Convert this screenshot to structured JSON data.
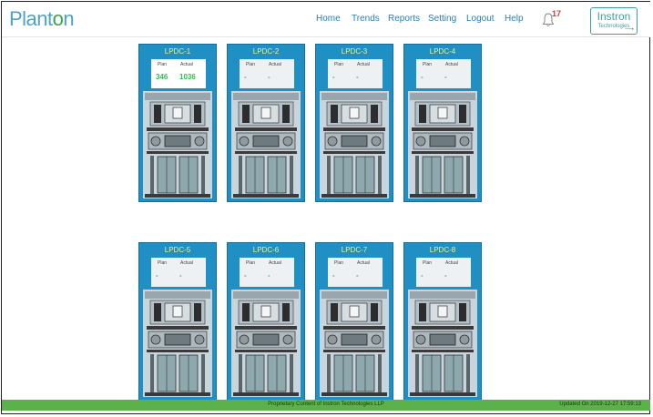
{
  "header": {
    "logo": {
      "pre": "Plant",
      "leaf": "o",
      "post": "n"
    },
    "nav": [
      "Home",
      "Trends",
      "Reports",
      "Setting",
      "Logout",
      "Help"
    ],
    "notification_count": "17",
    "brand": {
      "line1": "Instron",
      "line2": "Technologies"
    }
  },
  "cards": [
    {
      "title": "LPDC-1",
      "plan_label": "Plan",
      "actual_label": "Actual",
      "plan": "346",
      "actual": "1036"
    },
    {
      "title": "LPDC-2",
      "plan_label": "Plan",
      "actual_label": "Actual",
      "plan": "-",
      "actual": "-"
    },
    {
      "title": "LPDC-3",
      "plan_label": "Plan",
      "actual_label": "Actual",
      "plan": "-",
      "actual": "-"
    },
    {
      "title": "LPDC-4",
      "plan_label": "Plan",
      "actual_label": "Actual",
      "plan": "-",
      "actual": "-"
    },
    {
      "title": "LPDC-5",
      "plan_label": "Plan",
      "actual_label": "Actual",
      "plan": "-",
      "actual": "-"
    },
    {
      "title": "LPDC-6",
      "plan_label": "Plan",
      "actual_label": "Actual",
      "plan": "-",
      "actual": "-"
    },
    {
      "title": "LPDC-7",
      "plan_label": "Plan",
      "actual_label": "Actual",
      "plan": "-",
      "actual": "-"
    },
    {
      "title": "LPDC-8",
      "plan_label": "Plan",
      "actual_label": "Actual",
      "plan": "-",
      "actual": "-"
    }
  ],
  "footer": {
    "text": "Proprietary Content of Instron Technologies LLP",
    "updated": "Updated On 2019-12-27 17:59:13"
  },
  "colors": {
    "card": "#1f8fc4",
    "title": "#f4f27a",
    "value": "#2cc24a",
    "footer": "#5bb14a",
    "nav": "#2a7fb8"
  },
  "icons": {
    "notification": "bell-icon",
    "machine": "lpdc-machine-illustration"
  }
}
